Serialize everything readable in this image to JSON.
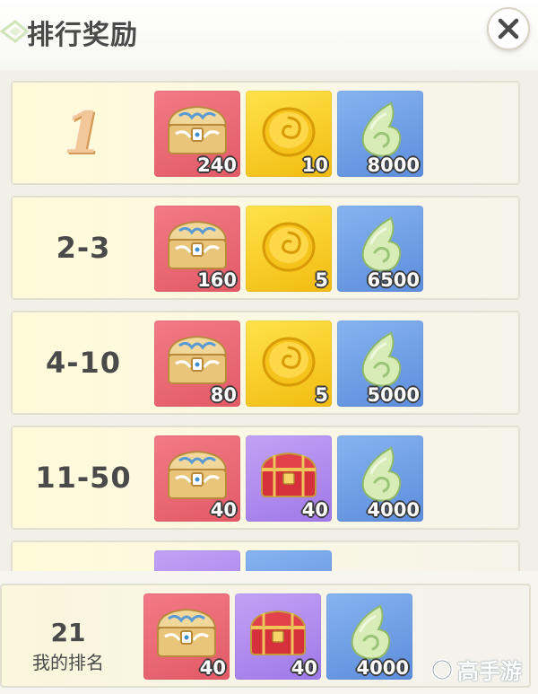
{
  "header": {
    "title": "排行奖励",
    "close_icon": "close-icon"
  },
  "icons": {
    "chest_gold": "ornate-gold-chest-icon",
    "coin": "swirl-gold-coin-icon",
    "jade": "green-jade-magatama-icon",
    "chest_red": "red-treasure-chest-icon"
  },
  "colors": {
    "red_tile": "#e35a66",
    "gold_tile": "#f2bb10",
    "blue_tile": "#5c8ddc",
    "purple_tile": "#9f78e8",
    "text": "#4a4a4a"
  },
  "tiers": [
    {
      "rank": "1",
      "rewards": [
        {
          "icon": "chest_gold",
          "bg": "red",
          "qty": "240"
        },
        {
          "icon": "coin",
          "bg": "gold",
          "qty": "10"
        },
        {
          "icon": "jade",
          "bg": "blue",
          "qty": "8000"
        }
      ]
    },
    {
      "rank": "2-3",
      "rewards": [
        {
          "icon": "chest_gold",
          "bg": "red",
          "qty": "160"
        },
        {
          "icon": "coin",
          "bg": "gold",
          "qty": "5"
        },
        {
          "icon": "jade",
          "bg": "blue",
          "qty": "6500"
        }
      ]
    },
    {
      "rank": "4-10",
      "rewards": [
        {
          "icon": "chest_gold",
          "bg": "red",
          "qty": "80"
        },
        {
          "icon": "coin",
          "bg": "gold",
          "qty": "5"
        },
        {
          "icon": "jade",
          "bg": "blue",
          "qty": "5000"
        }
      ]
    },
    {
      "rank": "11-50",
      "rewards": [
        {
          "icon": "chest_gold",
          "bg": "red",
          "qty": "40"
        },
        {
          "icon": "chest_red",
          "bg": "purple",
          "qty": "40"
        },
        {
          "icon": "jade",
          "bg": "blue",
          "qty": "4000"
        }
      ]
    }
  ],
  "my_rank": {
    "rank": "21",
    "label": "我的排名",
    "rewards": [
      {
        "icon": "chest_gold",
        "bg": "red",
        "qty": "40"
      },
      {
        "icon": "chest_red",
        "bg": "purple",
        "qty": "40"
      },
      {
        "icon": "jade",
        "bg": "blue",
        "qty": "4000"
      }
    ]
  },
  "watermark": {
    "text": "高手游"
  }
}
